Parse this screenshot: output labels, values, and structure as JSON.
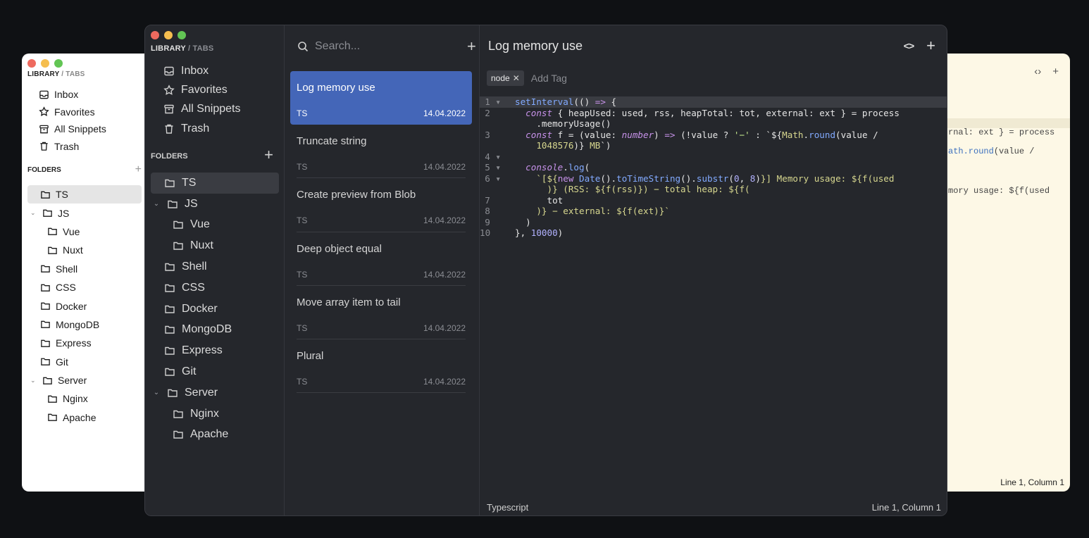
{
  "library": {
    "label": "LIBRARY",
    "separator": "/",
    "tabs": "TABS"
  },
  "nav": [
    {
      "label": "Inbox",
      "icon": "inbox-icon"
    },
    {
      "label": "Favorites",
      "icon": "star-icon"
    },
    {
      "label": "All Snippets",
      "icon": "archive-icon"
    },
    {
      "label": "Trash",
      "icon": "trash-icon"
    }
  ],
  "folders_header": "FOLDERS",
  "folders": [
    {
      "label": "TS",
      "depth": 0,
      "selected": true
    },
    {
      "label": "JS",
      "depth": 0,
      "expanded": true
    },
    {
      "label": "Vue",
      "depth": 1
    },
    {
      "label": "Nuxt",
      "depth": 1
    },
    {
      "label": "Shell",
      "depth": 0
    },
    {
      "label": "CSS",
      "depth": 0
    },
    {
      "label": "Docker",
      "depth": 0
    },
    {
      "label": "MongoDB",
      "depth": 0
    },
    {
      "label": "Express",
      "depth": 0
    },
    {
      "label": "Git",
      "depth": 0
    },
    {
      "label": "Server",
      "depth": 0,
      "expanded": true
    },
    {
      "label": "Nginx",
      "depth": 1
    },
    {
      "label": "Apache",
      "depth": 1
    }
  ],
  "search": {
    "placeholder": "Search..."
  },
  "snippets": [
    {
      "title": "Log memory use",
      "lang": "TS",
      "date": "14.04.2022",
      "selected": true
    },
    {
      "title": "Truncate string",
      "lang": "TS",
      "date": "14.04.2022"
    },
    {
      "title": "Create preview from Blob",
      "lang": "TS",
      "date": "14.04.2022"
    },
    {
      "title": "Deep object equal",
      "lang": "TS",
      "date": "14.04.2022"
    },
    {
      "title": "Move array item to tail",
      "lang": "TS",
      "date": "14.04.2022"
    },
    {
      "title": "Plural",
      "lang": "TS",
      "date": "14.04.2022"
    }
  ],
  "editor": {
    "title": "Log memory use",
    "tag": "node",
    "add_tag_placeholder": "Add Tag",
    "language": "Typescript",
    "cursor": "Line 1, Column 1",
    "line_numbers": [
      "1",
      "2",
      "3",
      "4",
      "5",
      "6",
      "7",
      "8",
      "9",
      "10"
    ]
  },
  "back_right": {
    "line1": "rnal: ext } = process",
    "line2_pre": "",
    "line2_fn": "ath.round",
    "line2_post": "(value /",
    "line3": "mory usage: ${f(used",
    "cursor": "Line 1, Column 1"
  },
  "colors": {
    "accent": "#4466b8",
    "bg_dark": "#25272c",
    "bg_outer": "#0f1114"
  }
}
